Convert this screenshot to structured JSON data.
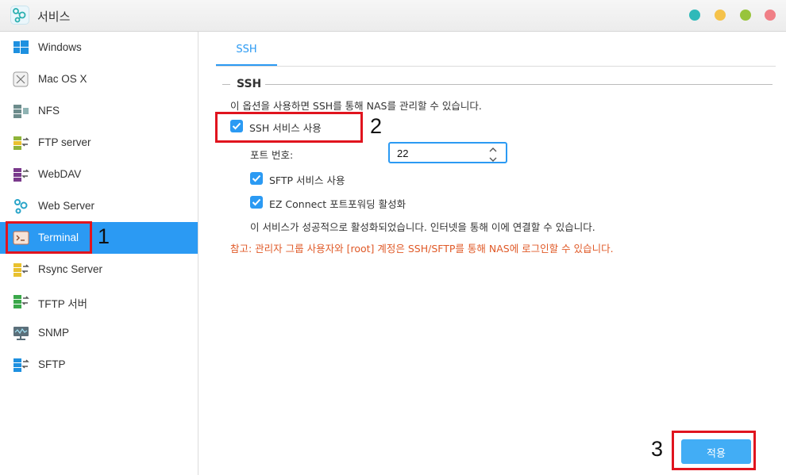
{
  "window": {
    "title": "서비스",
    "controls": [
      "teal-dot",
      "yellow-dot",
      "green-dot",
      "red-dot"
    ]
  },
  "sidebar": {
    "items": [
      {
        "label": "Windows",
        "icon": "windows-icon"
      },
      {
        "label": "Mac OS X",
        "icon": "macos-icon"
      },
      {
        "label": "NFS",
        "icon": "nfs-icon"
      },
      {
        "label": "FTP server",
        "icon": "ftp-icon"
      },
      {
        "label": "WebDAV",
        "icon": "webdav-icon"
      },
      {
        "label": "Web Server",
        "icon": "web-server-icon"
      },
      {
        "label": "Terminal",
        "icon": "terminal-icon",
        "active": true
      },
      {
        "label": "Rsync Server",
        "icon": "rsync-icon"
      },
      {
        "label": "TFTP 서버",
        "icon": "tftp-icon"
      },
      {
        "label": "SNMP",
        "icon": "snmp-icon"
      },
      {
        "label": "SFTP",
        "icon": "sftp-icon"
      }
    ]
  },
  "main": {
    "tab": "SSH",
    "section_title": "SSH",
    "description": "이 옵션을 사용하면 SSH를 통해 NAS를 관리할 수 있습니다.",
    "ssh_enable_label": "SSH 서비스 사용",
    "port_label": "포트 번호:",
    "port_value": "22",
    "sftp_label": "SFTP 서비스 사용",
    "ez_connect_label": "EZ Connect 포트포워딩 활성화",
    "status": "이 서비스가 성공적으로 활성화되었습니다. 인터넷을 통해 이에 연결할 수 있습니다.",
    "note": "참고: 관리자 그룹 사용자와 [root] 계정은 SSH/SFTP를 통해 NAS에 로그인할 수 있습니다.",
    "apply_label": "적용"
  },
  "annotations": {
    "one": "1",
    "two": "2",
    "three": "3"
  },
  "colors": {
    "accent": "#2b9af3",
    "annotation": "#e0141e",
    "note": "#e05a28"
  }
}
